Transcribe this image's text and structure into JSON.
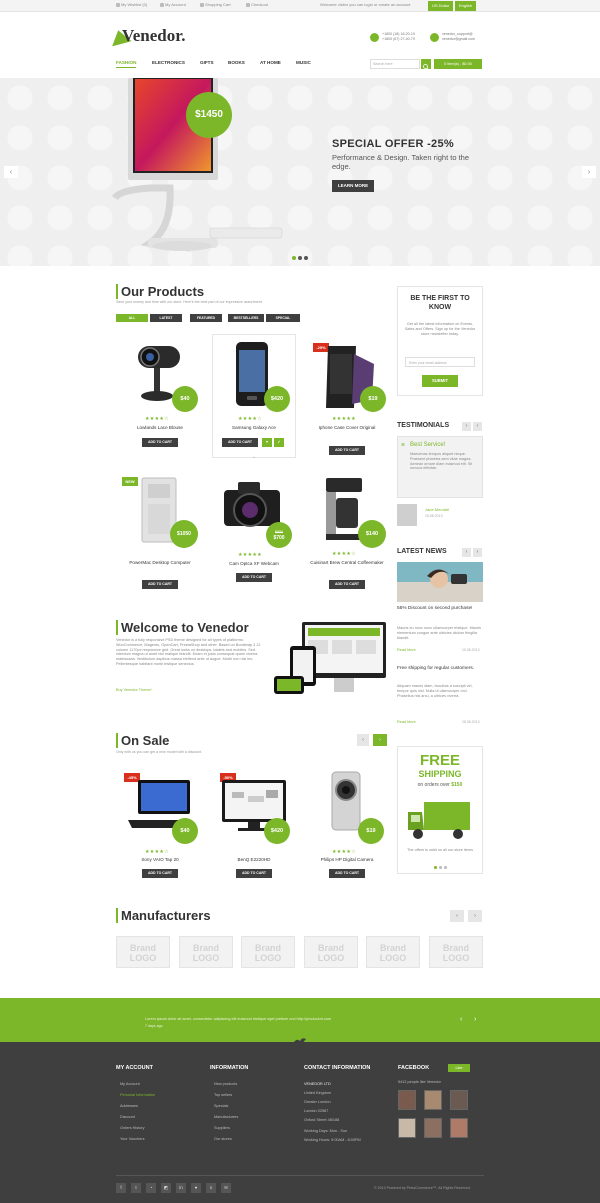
{
  "topbar": {
    "links": [
      "My Wishlist (0)",
      "My Account",
      "Shopping Cart",
      "Checkout"
    ],
    "welcome": "Welcome visitor you can login or create an account",
    "usd": "US Dollar",
    "lang": "English"
  },
  "header": {
    "logo": "Venedor.",
    "phone1": "+1800 (18) 18-20-19",
    "phone2": "+1800 (67) 27-40-79",
    "email1": "venedor_support@",
    "email2": "venedor@gmail.com"
  },
  "nav": {
    "items": [
      "FASHION",
      "ELECTRONICS",
      "GIFTS",
      "BOOKS",
      "AT HOME",
      "MUSIC"
    ],
    "search_placeholder": "Search here",
    "cart": "0 item(s) - $0.00"
  },
  "hero": {
    "price": "$1450",
    "title": "SPECIAL OFFER -25%",
    "subtitle": "Performance & Design. Taken right to the edge.",
    "button": "LEARN MORE"
  },
  "products": {
    "title": "Our Products",
    "subtitle": "Save your money and time with our store. Here's the best part of our impressive assortment.",
    "tabs": [
      "ALL",
      "LATEST",
      "FEATURED",
      "BESTSELLERS",
      "SPECIAL"
    ],
    "add_to_cart": "ADD TO CART",
    "items": [
      {
        "name": "Lowlands Lace Blouse",
        "price": "$40",
        "badge": ""
      },
      {
        "name": "Samsung Galaxy Ace",
        "price": "$420",
        "badge": ""
      },
      {
        "name": "Iphone Case Cover Original",
        "price": "$19",
        "badge": "-25%"
      },
      {
        "name": "PowerMac Desktop Computer",
        "price": "$1050",
        "badge": "NEW"
      },
      {
        "name": "Cam Optca XF Webcam",
        "price": "$700",
        "old_price": "$850",
        "badge": ""
      },
      {
        "name": "Cuisinart Brew Central Coffeemaker",
        "price": "$140",
        "badge": ""
      }
    ]
  },
  "newsletter": {
    "title": "BE THE FIRST TO KNOW",
    "text": "Get all the latest information on Events, Sales and Offers. Sign up for the Venedor store newsletter today.",
    "placeholder": "Enter your email address",
    "button": "SUBMIT"
  },
  "testimonials": {
    "title": "TESTIMONIALS",
    "quote_title": "Best Service!",
    "quote": "Maecenas tempus aliquet neque. Praesent pharetra sem vitae magna. Aenean ornare diam euismod elit. Sit nuncus elitvitae.",
    "author": "Jane Mendall",
    "date": "15.08.2013"
  },
  "news": {
    "title": "LATEST NEWS",
    "items": [
      {
        "title": "55% Discount on second purchase!",
        "text": "Mauris eu nunc nunc ullamcorper tristique. Mauris elementum congue ante ultricies dictum fringilla blandit.",
        "more": "Read More",
        "date": "15.08.2013"
      },
      {
        "title": "Free shipping for regular customers.",
        "text": "Aliquam mauris diam, faucibus a suscipit vel, tempor quis nisl. Nulla ut ullamcorper orci. Phasellus nisl arcu, a ultrices viverra.",
        "more": "Read More",
        "date": "28.08.2013"
      }
    ]
  },
  "welcome": {
    "title": "Welcome to Venedor",
    "text": "Venedor is a fully responsive PSD theme designed for all types of platforms: WooCommerce, Magento, OpenCart, PrestaShop and other. Based on Bootstrap 3 12 column 1170px responsive grid. Great looks on desktops, tablets and mobiles. Sed interdum magna ut amet nisi malique blandit. Enam et justo consequat quam viverra malesuada. Vestibulum dapibus massa eleifend ante ut augue. Morbi non nisi leo. Pellentesque habitant morbi tristique senectus.",
    "link": "Buy Venedor Theme!"
  },
  "onsale": {
    "title": "On Sale",
    "subtitle": "Only with us you can get a new model with a discount.",
    "items": [
      {
        "name": "Sony VAIO Tap 20",
        "price": "$40",
        "badge": "-45%"
      },
      {
        "name": "BenQ E2220HD",
        "price": "$420",
        "badge": "-50%"
      },
      {
        "name": "Philips HP Digital Camera",
        "price": "$19",
        "badge": ""
      }
    ]
  },
  "shipping": {
    "title1": "FREE",
    "title2": "SHIPPING",
    "sub": "on orders over",
    "amount": "$150",
    "note": "The offers is valid on all our store items"
  },
  "manufacturers": {
    "title": "Manufacturers",
    "brands": [
      "Brand LOGO",
      "Brand LOGO",
      "Brand LOGO",
      "Brand LOGO",
      "Brand LOGO",
      "Brand LOGO"
    ]
  },
  "tweet": {
    "text": "Lorem ipsum dolor sit amet, consectetur adipiscing elit euismod tristique eget pretium orci http://producturl.com",
    "time": "7 days ago"
  },
  "footer": {
    "account_title": "MY ACCOUNT",
    "account_links": [
      "My Account",
      "Personal Information",
      "Addresses",
      "Discount",
      "Orders History",
      "Your Vouchers"
    ],
    "info_title": "INFORMATION",
    "info_links": [
      "New products",
      "Top sellers",
      "Specials",
      "Manufacturers",
      "Suppliers",
      "Our stores"
    ],
    "contact_title": "CONTACT INFORMATION",
    "contact_lines": [
      "VENEDOR LTD",
      "United Kingdom",
      "Greater London",
      "London 02587",
      "Oxford Street 48/188",
      "Working Days: Mon - Sun",
      "Working Hours: 9:00AM - 8:00PM"
    ],
    "facebook_title": "FACEBOOK",
    "like": "Like",
    "fb_people": "5412 people like Venedor",
    "copyright": "© 2013 Powered by PetraCommerce™. All Rights Reserved."
  },
  "colors": {
    "accent": "#7cb72a",
    "dark": "#3f3f3f"
  }
}
